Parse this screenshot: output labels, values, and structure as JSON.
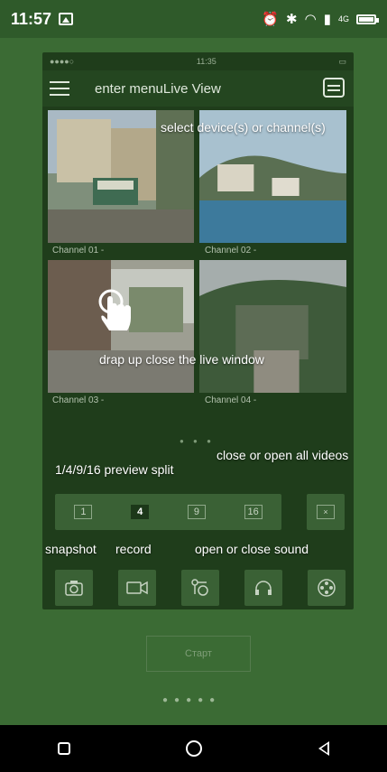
{
  "status_bar": {
    "time": "11:57",
    "network_label": "4G"
  },
  "inner_status": {
    "carrier": "●●●●○",
    "time": "11:35"
  },
  "header": {
    "title_overlay": "enter menu",
    "title": "Live View"
  },
  "annotations": {
    "select_device": "select device(s) or channel(s)",
    "drag_up": "drap up close the live window",
    "close_open_videos": "close or open all videos",
    "preview_split": "1/4/9/16 preview split",
    "snapshot": "snapshot",
    "record": "record",
    "sound": "open or close sound"
  },
  "channels": [
    {
      "label": "Channel 01 -"
    },
    {
      "label": "Channel 02 -"
    },
    {
      "label": "Channel 03 -"
    },
    {
      "label": "Channel 04 -"
    }
  ],
  "split_options": [
    "1",
    "4",
    "9",
    "16"
  ],
  "selected_split": "4",
  "close_all_label": "×",
  "toolbar_icons": [
    "camera-icon",
    "video-icon",
    "ptz-icon",
    "headphones-icon",
    "film-reel-icon"
  ],
  "start_button": "Старт",
  "colors": {
    "background": "#3b6b34",
    "panel": "#1f3d1b",
    "button": "#3a6135"
  }
}
